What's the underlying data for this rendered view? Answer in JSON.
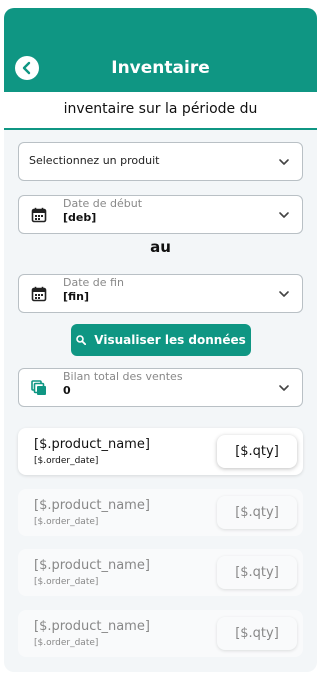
{
  "header": {
    "title": "Inventaire"
  },
  "subtitle": "inventaire sur la période du",
  "product_select": {
    "placeholder": "Selectionnez un produit"
  },
  "start_date": {
    "label": "Date de début",
    "value": "[deb]"
  },
  "separator": "au",
  "end_date": {
    "label": "Date de fin",
    "value": "[fin]"
  },
  "visualize_button": {
    "label": "Visualiser les données"
  },
  "sales_total": {
    "label": "Bilan total des ventes",
    "value": "0"
  },
  "items": [
    {
      "name": "[$.product_name]",
      "date": "[$.order_date]",
      "qty": "[$.qty]"
    },
    {
      "name": "[$.product_name]",
      "date": "[$.order_date]",
      "qty": "[$.qty]"
    },
    {
      "name": "[$.product_name]",
      "date": "[$.order_date]",
      "qty": "[$.qty]"
    },
    {
      "name": "[$.product_name]",
      "date": "[$.order_date]",
      "qty": "[$.qty]"
    }
  ],
  "colors": {
    "accent": "#0f9683",
    "background": "#f3f6f8"
  },
  "icons": {
    "back": "back-chevron-icon",
    "calendar": "calendar-icon",
    "search": "search-icon",
    "sales": "copy-stack-icon",
    "dropdown": "chevron-down-icon"
  }
}
